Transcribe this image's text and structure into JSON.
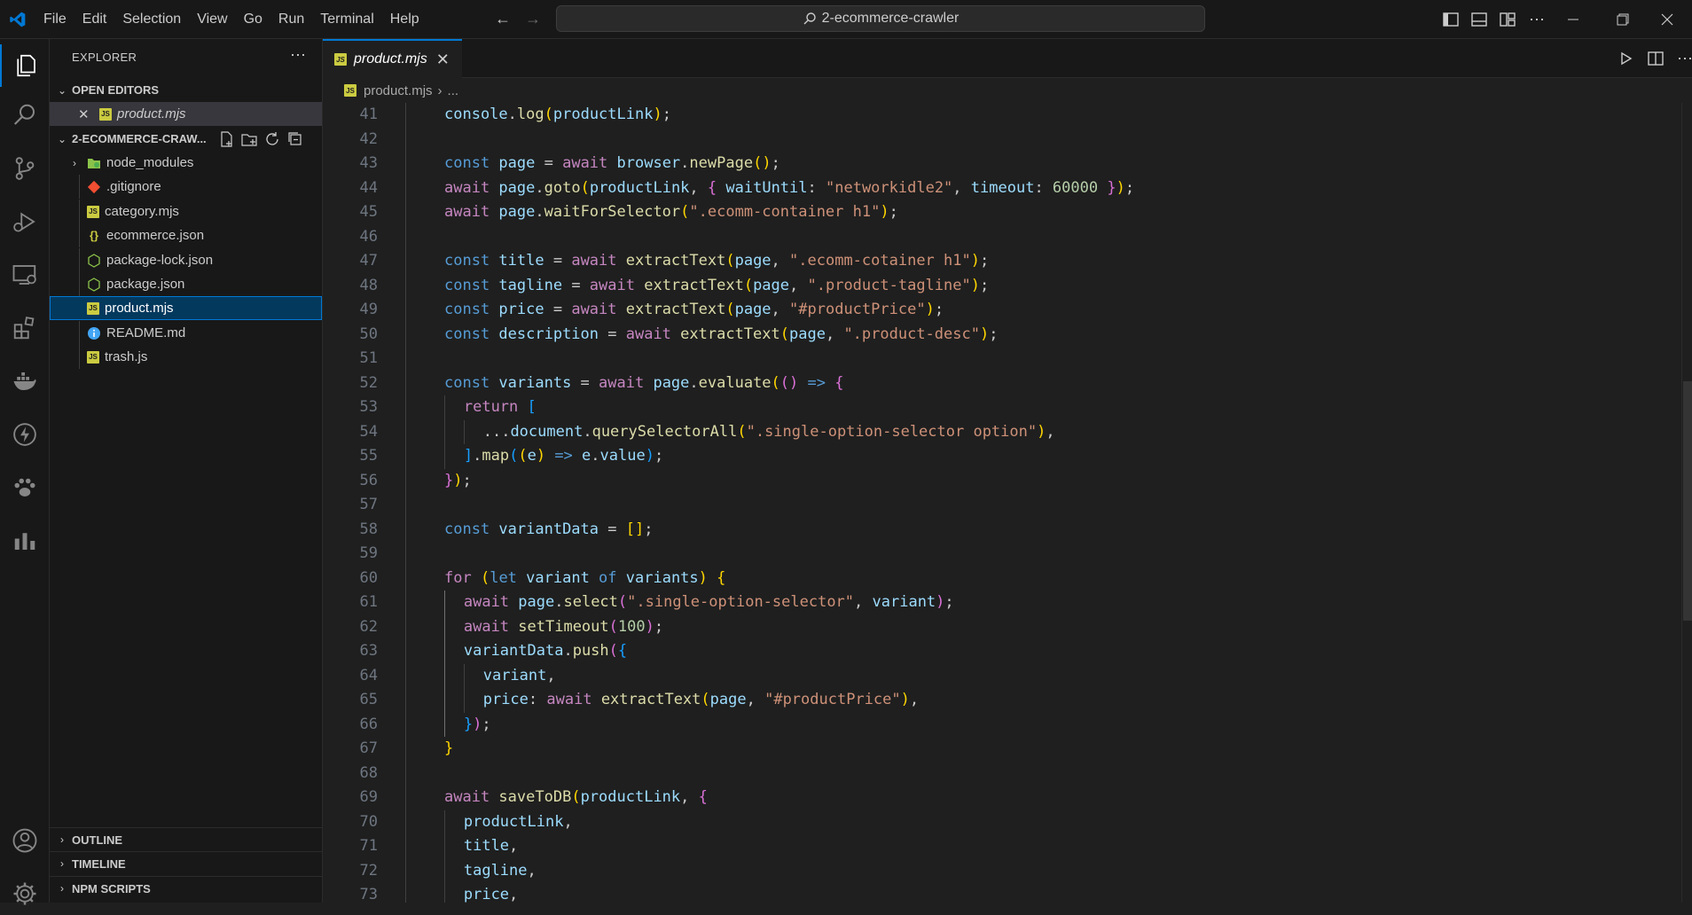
{
  "titlebar": {
    "menu": [
      "File",
      "Edit",
      "Selection",
      "View",
      "Go",
      "Run",
      "Terminal",
      "Help"
    ],
    "search_text": "2-ecommerce-crawler"
  },
  "sidebar": {
    "header": "EXPLORER",
    "open_editors_label": "OPEN EDITORS",
    "open_editor_file": "product.mjs",
    "project_label": "2-ECOMMERCE-CRAW...",
    "files": [
      {
        "name": "node_modules",
        "icon": "folder-node-icon"
      },
      {
        "name": ".gitignore",
        "icon": "git-icon"
      },
      {
        "name": "category.mjs",
        "icon": "js-file-icon"
      },
      {
        "name": "ecommerce.json",
        "icon": "json-icon"
      },
      {
        "name": "package-lock.json",
        "icon": "node-package-icon"
      },
      {
        "name": "package.json",
        "icon": "node-package-icon"
      },
      {
        "name": "product.mjs",
        "icon": "js-file-icon"
      },
      {
        "name": "README.md",
        "icon": "info-icon"
      },
      {
        "name": "trash.js",
        "icon": "js-file-icon"
      }
    ],
    "bottom_sections": [
      "OUTLINE",
      "TIMELINE",
      "NPM SCRIPTS"
    ]
  },
  "editor": {
    "tab_title": "product.mjs",
    "breadcrumb_file": "product.mjs",
    "breadcrumb_more": "...",
    "first_line_number": 41,
    "lines": [
      [
        [
          2,
          ""
        ],
        [
          "v",
          "console"
        ],
        [
          "p",
          "."
        ],
        [
          "f",
          "log"
        ],
        [
          "b1",
          "("
        ],
        [
          "v",
          "productLink"
        ],
        [
          "b1",
          ")"
        ],
        [
          "p",
          ";"
        ]
      ],
      [
        [
          2,
          ""
        ]
      ],
      [
        [
          2,
          ""
        ],
        [
          "k",
          "const "
        ],
        [
          "v",
          "page"
        ],
        [
          "p",
          " = "
        ],
        [
          "c",
          "await "
        ],
        [
          "v",
          "browser"
        ],
        [
          "p",
          "."
        ],
        [
          "f",
          "newPage"
        ],
        [
          "b1",
          "()"
        ],
        [
          "p",
          ";"
        ]
      ],
      [
        [
          2,
          ""
        ],
        [
          "c",
          "await "
        ],
        [
          "v",
          "page"
        ],
        [
          "p",
          "."
        ],
        [
          "f",
          "goto"
        ],
        [
          "b1",
          "("
        ],
        [
          "v",
          "productLink"
        ],
        [
          "p",
          ", "
        ],
        [
          "b2",
          "{ "
        ],
        [
          "v",
          "waitUntil"
        ],
        [
          "p",
          ": "
        ],
        [
          "s",
          "\"networkidle2\""
        ],
        [
          "p",
          ", "
        ],
        [
          "v",
          "timeout"
        ],
        [
          "p",
          ": "
        ],
        [
          "n",
          "60000"
        ],
        [
          "b2",
          " }"
        ],
        [
          "b1",
          ")"
        ],
        [
          "p",
          ";"
        ]
      ],
      [
        [
          2,
          ""
        ],
        [
          "c",
          "await "
        ],
        [
          "v",
          "page"
        ],
        [
          "p",
          "."
        ],
        [
          "f",
          "waitForSelector"
        ],
        [
          "b1",
          "("
        ],
        [
          "s",
          "\".ecomm-container h1\""
        ],
        [
          "b1",
          ")"
        ],
        [
          "p",
          ";"
        ]
      ],
      [
        [
          2,
          ""
        ]
      ],
      [
        [
          2,
          ""
        ],
        [
          "k",
          "const "
        ],
        [
          "v",
          "title"
        ],
        [
          "p",
          " = "
        ],
        [
          "c",
          "await "
        ],
        [
          "f",
          "extractText"
        ],
        [
          "b1",
          "("
        ],
        [
          "v",
          "page"
        ],
        [
          "p",
          ", "
        ],
        [
          "s",
          "\".ecomm-cotainer h1\""
        ],
        [
          "b1",
          ")"
        ],
        [
          "p",
          ";"
        ]
      ],
      [
        [
          2,
          ""
        ],
        [
          "k",
          "const "
        ],
        [
          "v",
          "tagline"
        ],
        [
          "p",
          " = "
        ],
        [
          "c",
          "await "
        ],
        [
          "f",
          "extractText"
        ],
        [
          "b1",
          "("
        ],
        [
          "v",
          "page"
        ],
        [
          "p",
          ", "
        ],
        [
          "s",
          "\".product-tagline\""
        ],
        [
          "b1",
          ")"
        ],
        [
          "p",
          ";"
        ]
      ],
      [
        [
          2,
          ""
        ],
        [
          "k",
          "const "
        ],
        [
          "v",
          "price"
        ],
        [
          "p",
          " = "
        ],
        [
          "c",
          "await "
        ],
        [
          "f",
          "extractText"
        ],
        [
          "b1",
          "("
        ],
        [
          "v",
          "page"
        ],
        [
          "p",
          ", "
        ],
        [
          "s",
          "\"#productPrice\""
        ],
        [
          "b1",
          ")"
        ],
        [
          "p",
          ";"
        ]
      ],
      [
        [
          2,
          ""
        ],
        [
          "k",
          "const "
        ],
        [
          "v",
          "description"
        ],
        [
          "p",
          " = "
        ],
        [
          "c",
          "await "
        ],
        [
          "f",
          "extractText"
        ],
        [
          "b1",
          "("
        ],
        [
          "v",
          "page"
        ],
        [
          "p",
          ", "
        ],
        [
          "s",
          "\".product-desc\""
        ],
        [
          "b1",
          ")"
        ],
        [
          "p",
          ";"
        ]
      ],
      [
        [
          2,
          ""
        ]
      ],
      [
        [
          2,
          ""
        ],
        [
          "k",
          "const "
        ],
        [
          "v",
          "variants"
        ],
        [
          "p",
          " = "
        ],
        [
          "c",
          "await "
        ],
        [
          "v",
          "page"
        ],
        [
          "p",
          "."
        ],
        [
          "f",
          "evaluate"
        ],
        [
          "b1",
          "("
        ],
        [
          "b2",
          "()"
        ],
        [
          "k",
          " => "
        ],
        [
          "b2",
          "{"
        ]
      ],
      [
        [
          3,
          ""
        ],
        [
          "c",
          "return "
        ],
        [
          "b3",
          "["
        ]
      ],
      [
        [
          4,
          ""
        ],
        [
          "p",
          "..."
        ],
        [
          "v",
          "document"
        ],
        [
          "p",
          "."
        ],
        [
          "f",
          "querySelectorAll"
        ],
        [
          "b1",
          "("
        ],
        [
          "s",
          "\".single-option-selector option\""
        ],
        [
          "b1",
          ")"
        ],
        [
          "p",
          ","
        ]
      ],
      [
        [
          3,
          ""
        ],
        [
          "b3",
          "]"
        ],
        [
          "p",
          "."
        ],
        [
          "f",
          "map"
        ],
        [
          "b3",
          "("
        ],
        [
          "b1",
          "("
        ],
        [
          "v",
          "e"
        ],
        [
          "b1",
          ")"
        ],
        [
          "k",
          " => "
        ],
        [
          "v",
          "e"
        ],
        [
          "p",
          "."
        ],
        [
          "v",
          "value"
        ],
        [
          "b3",
          ")"
        ],
        [
          "p",
          ";"
        ]
      ],
      [
        [
          2,
          ""
        ],
        [
          "b2",
          "}"
        ],
        [
          "b1",
          ")"
        ],
        [
          "p",
          ";"
        ]
      ],
      [
        [
          2,
          ""
        ]
      ],
      [
        [
          2,
          ""
        ],
        [
          "k",
          "const "
        ],
        [
          "v",
          "variantData"
        ],
        [
          "p",
          " = "
        ],
        [
          "b1",
          "[]"
        ],
        [
          "p",
          ";"
        ]
      ],
      [
        [
          2,
          ""
        ]
      ],
      [
        [
          2,
          ""
        ],
        [
          "c",
          "for "
        ],
        [
          "b1",
          "("
        ],
        [
          "k",
          "let "
        ],
        [
          "v",
          "variant "
        ],
        [
          "k",
          "of "
        ],
        [
          "v",
          "variants"
        ],
        [
          "b1",
          ")"
        ],
        [
          "p",
          " "
        ],
        [
          "b1",
          "{"
        ]
      ],
      [
        [
          3,
          ""
        ],
        [
          "c",
          "await "
        ],
        [
          "v",
          "page"
        ],
        [
          "p",
          "."
        ],
        [
          "f",
          "select"
        ],
        [
          "b2",
          "("
        ],
        [
          "s",
          "\".single-option-selector\""
        ],
        [
          "p",
          ", "
        ],
        [
          "v",
          "variant"
        ],
        [
          "b2",
          ")"
        ],
        [
          "p",
          ";"
        ]
      ],
      [
        [
          3,
          ""
        ],
        [
          "c",
          "await "
        ],
        [
          "f",
          "setTimeout"
        ],
        [
          "b2",
          "("
        ],
        [
          "n",
          "100"
        ],
        [
          "b2",
          ")"
        ],
        [
          "p",
          ";"
        ]
      ],
      [
        [
          3,
          ""
        ],
        [
          "v",
          "variantData"
        ],
        [
          "p",
          "."
        ],
        [
          "f",
          "push"
        ],
        [
          "b2",
          "("
        ],
        [
          "b3",
          "{"
        ]
      ],
      [
        [
          4,
          ""
        ],
        [
          "v",
          "variant"
        ],
        [
          "p",
          ","
        ]
      ],
      [
        [
          4,
          ""
        ],
        [
          "v",
          "price"
        ],
        [
          "p",
          ": "
        ],
        [
          "c",
          "await "
        ],
        [
          "f",
          "extractText"
        ],
        [
          "b1",
          "("
        ],
        [
          "v",
          "page"
        ],
        [
          "p",
          ", "
        ],
        [
          "s",
          "\"#productPrice\""
        ],
        [
          "b1",
          ")"
        ],
        [
          "p",
          ","
        ]
      ],
      [
        [
          3,
          ""
        ],
        [
          "b3",
          "}"
        ],
        [
          "b2",
          ")"
        ],
        [
          "p",
          ";"
        ]
      ],
      [
        [
          2,
          ""
        ],
        [
          "b1",
          "}"
        ]
      ],
      [
        [
          2,
          ""
        ]
      ],
      [
        [
          2,
          ""
        ],
        [
          "c",
          "await "
        ],
        [
          "f",
          "saveToDB"
        ],
        [
          "b1",
          "("
        ],
        [
          "v",
          "productLink"
        ],
        [
          "p",
          ", "
        ],
        [
          "b2",
          "{"
        ]
      ],
      [
        [
          3,
          ""
        ],
        [
          "v",
          "productLink"
        ],
        [
          "p",
          ","
        ]
      ],
      [
        [
          3,
          ""
        ],
        [
          "v",
          "title"
        ],
        [
          "p",
          ","
        ]
      ],
      [
        [
          3,
          ""
        ],
        [
          "v",
          "tagline"
        ],
        [
          "p",
          ","
        ]
      ],
      [
        [
          3,
          ""
        ],
        [
          "v",
          "price"
        ],
        [
          "p",
          ","
        ]
      ]
    ]
  },
  "colors": {
    "accent": "#0078d4",
    "background": "#1f1f1f",
    "sidebar": "#181818"
  }
}
